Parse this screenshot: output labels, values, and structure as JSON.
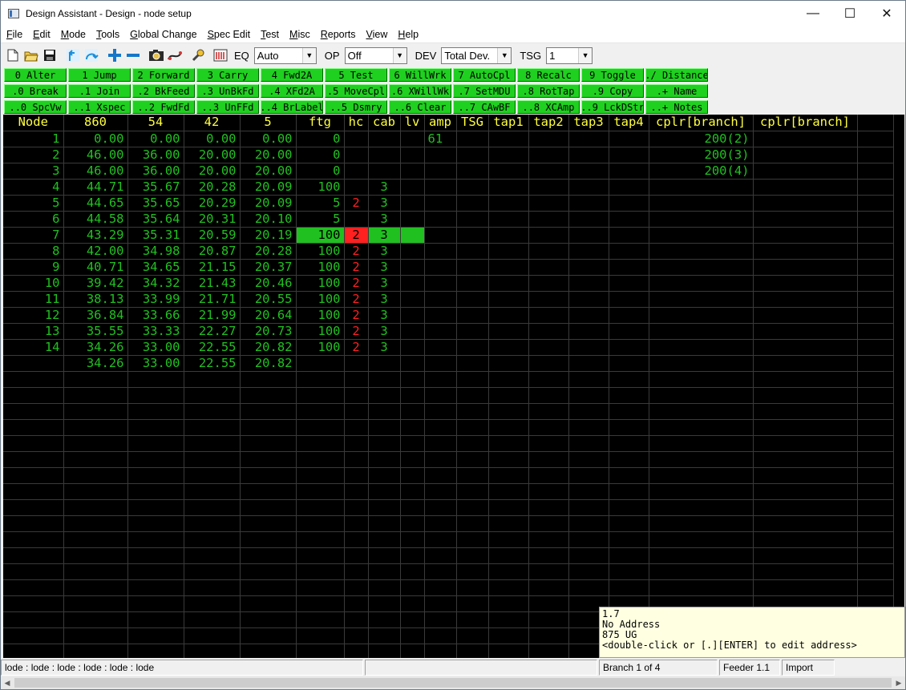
{
  "window": {
    "title": "Design Assistant - Design - node setup"
  },
  "menu": [
    "File",
    "Edit",
    "Mode",
    "Tools",
    "Global Change",
    "Spec Edit",
    "Test",
    "Misc",
    "Reports",
    "View",
    "Help"
  ],
  "toolbar": {
    "eq_label": "EQ",
    "eq_value": "Auto",
    "op_label": "OP",
    "op_value": "Off",
    "dev_label": "DEV",
    "dev_value": "Total Dev.",
    "tsg_label": "TSG",
    "tsg_value": "1"
  },
  "fkeys": [
    [
      "0 Alter",
      "1 Jump",
      "2 Forward",
      "3 Carry",
      "4 Fwd2A",
      "5 Test",
      "6 WillWrk",
      "7 AutoCpl",
      "8 Recalc",
      "9 Toggle",
      "./ Distance"
    ],
    [
      ".0 Break",
      ".1 Join",
      ".2 BkFeed",
      ".3 UnBkFd",
      ".4 XFd2A",
      ".5 MoveCpl",
      ".6 XWillWk",
      ".7 SetMDU",
      ".8 RotTap",
      ".9 Copy",
      ".+ Name"
    ],
    [
      "..0 SpcVw",
      "..1 Xspec",
      "..2 FwdFd",
      "..3 UnFFd",
      "..4 BrLabel",
      "..5 Dsmry",
      "..6 Clear",
      "..7 CAwBF",
      "..8 XCAmp",
      "..9 LckDStr",
      "..+ Notes"
    ]
  ],
  "grid": {
    "headers": [
      "Node",
      "860",
      "54",
      "42",
      "5",
      "ftg",
      "hc",
      "cab",
      "lv",
      "amp",
      "TSG",
      "tap1",
      "tap2",
      "tap3",
      "tap4",
      "cplr[branch]",
      "cplr[branch]"
    ],
    "rows": [
      [
        "1",
        "0.00",
        "0.00",
        "0.00",
        "0.00",
        "0",
        "",
        "",
        "",
        "61",
        "",
        "",
        "",
        "",
        "",
        "200(2)",
        ""
      ],
      [
        "2",
        "46.00",
        "36.00",
        "20.00",
        "20.00",
        "0",
        "",
        "",
        "",
        "",
        "",
        "",
        "",
        "",
        "",
        "200(3)",
        ""
      ],
      [
        "3",
        "46.00",
        "36.00",
        "20.00",
        "20.00",
        "0",
        "",
        "",
        "",
        "",
        "",
        "",
        "",
        "",
        "",
        "200(4)",
        ""
      ],
      [
        "4",
        "44.71",
        "35.67",
        "20.28",
        "20.09",
        "100",
        "",
        "3",
        "",
        "",
        "",
        "",
        "",
        "",
        "",
        "",
        ""
      ],
      [
        "5",
        "44.65",
        "35.65",
        "20.29",
        "20.09",
        "5",
        "2",
        "3",
        "",
        "",
        "",
        "",
        "",
        "",
        "",
        "",
        ""
      ],
      [
        "6",
        "44.58",
        "35.64",
        "20.31",
        "20.10",
        "5",
        "",
        "3",
        "",
        "",
        "",
        "",
        "",
        "",
        "",
        "",
        ""
      ],
      [
        "7",
        "43.29",
        "35.31",
        "20.59",
        "20.19",
        "100",
        "2",
        "3",
        "",
        "",
        "",
        "",
        "",
        "",
        "",
        "",
        ""
      ],
      [
        "8",
        "42.00",
        "34.98",
        "20.87",
        "20.28",
        "100",
        "2",
        "3",
        "",
        "",
        "",
        "",
        "",
        "",
        "",
        "",
        ""
      ],
      [
        "9",
        "40.71",
        "34.65",
        "21.15",
        "20.37",
        "100",
        "2",
        "3",
        "",
        "",
        "",
        "",
        "",
        "",
        "",
        "",
        ""
      ],
      [
        "10",
        "39.42",
        "34.32",
        "21.43",
        "20.46",
        "100",
        "2",
        "3",
        "",
        "",
        "",
        "",
        "",
        "",
        "",
        "",
        ""
      ],
      [
        "11",
        "38.13",
        "33.99",
        "21.71",
        "20.55",
        "100",
        "2",
        "3",
        "",
        "",
        "",
        "",
        "",
        "",
        "",
        "",
        ""
      ],
      [
        "12",
        "36.84",
        "33.66",
        "21.99",
        "20.64",
        "100",
        "2",
        "3",
        "",
        "",
        "",
        "",
        "",
        "",
        "",
        "",
        ""
      ],
      [
        "13",
        "35.55",
        "33.33",
        "22.27",
        "20.73",
        "100",
        "2",
        "3",
        "",
        "",
        "",
        "",
        "",
        "",
        "",
        "",
        ""
      ],
      [
        "14",
        "34.26",
        "33.00",
        "22.55",
        "20.82",
        "100",
        "2",
        "3",
        "",
        "",
        "",
        "",
        "",
        "",
        "",
        "",
        ""
      ],
      [
        "",
        "34.26",
        "33.00",
        "22.55",
        "20.82",
        "",
        "",
        "",
        "",
        "",
        "",
        "",
        "",
        "",
        "",
        "",
        ""
      ]
    ],
    "selected_row": 6,
    "empty_rows": 18
  },
  "infobox": {
    "lines": [
      "1.7",
      "No Address",
      "875 UG",
      "<double-click or [.][ENTER] to edit address>"
    ]
  },
  "status": {
    "left": "lode : lode : lode : lode : lode : lode",
    "middle": "",
    "branch": "Branch 1 of 4",
    "feeder": "Feeder 1.1",
    "import": "Import"
  },
  "colors": {
    "grid_bg": "#000000",
    "grid_text": "#20c020",
    "header_text": "#ffff40",
    "alert": "#ff2020",
    "fkey_bg": "#20d020"
  }
}
